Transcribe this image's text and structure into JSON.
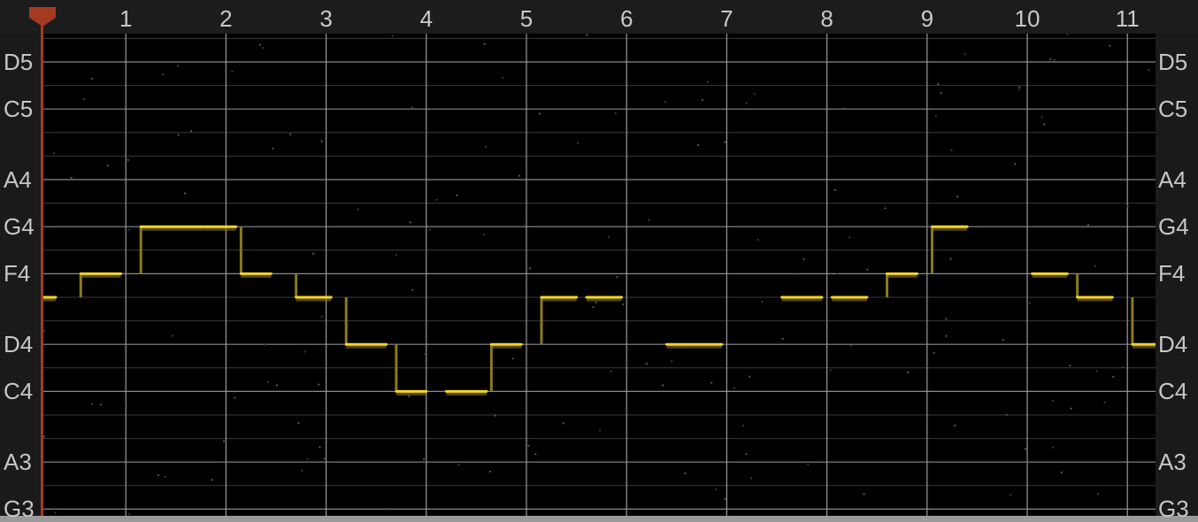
{
  "ruler": {
    "bars": [
      "1",
      "2",
      "3",
      "4",
      "5",
      "6",
      "7",
      "8",
      "9",
      "10",
      "11"
    ]
  },
  "notes": [
    {
      "name": "D5",
      "midi": 74
    },
    {
      "name": "C5",
      "midi": 72
    },
    {
      "name": "A4",
      "midi": 69
    },
    {
      "name": "G4",
      "midi": 67
    },
    {
      "name": "F4",
      "midi": 65
    },
    {
      "name": "D4",
      "midi": 62
    },
    {
      "name": "C4",
      "midi": 60
    },
    {
      "name": "A3",
      "midi": 57
    },
    {
      "name": "G3",
      "midi": 55
    }
  ],
  "pitch_segments": [
    {
      "start": 0.0,
      "end": 0.3,
      "note": "E4"
    },
    {
      "start": 0.55,
      "end": 0.95,
      "note": "F4"
    },
    {
      "start": 1.15,
      "end": 1.75,
      "note": "G4"
    },
    {
      "start": 1.75,
      "end": 2.1,
      "note": "G4"
    },
    {
      "start": 2.15,
      "end": 2.45,
      "note": "F4"
    },
    {
      "start": 2.7,
      "end": 3.05,
      "note": "E4"
    },
    {
      "start": 3.2,
      "end": 3.6,
      "note": "D4"
    },
    {
      "start": 3.7,
      "end": 4.0,
      "note": "C4"
    },
    {
      "start": 4.2,
      "end": 4.6,
      "note": "C4"
    },
    {
      "start": 4.65,
      "end": 4.95,
      "note": "D4"
    },
    {
      "start": 5.15,
      "end": 5.5,
      "note": "E4"
    },
    {
      "start": 5.6,
      "end": 5.95,
      "note": "E4"
    },
    {
      "start": 6.4,
      "end": 6.95,
      "note": "D4"
    },
    {
      "start": 7.55,
      "end": 7.95,
      "note": "E4"
    },
    {
      "start": 8.05,
      "end": 8.4,
      "note": "E4"
    },
    {
      "start": 8.6,
      "end": 8.9,
      "note": "F4"
    },
    {
      "start": 9.05,
      "end": 9.4,
      "note": "G4"
    },
    {
      "start": 10.05,
      "end": 10.4,
      "note": "F4"
    },
    {
      "start": 10.5,
      "end": 10.85,
      "note": "E4"
    },
    {
      "start": 11.05,
      "end": 11.3,
      "note": "D4"
    }
  ],
  "colors": {
    "pitch": "#f2d42b",
    "pitch_faint": "#8a7a1c",
    "playhead": "#a43a22",
    "grid_major": "#8a8a8a",
    "grid_minor": "#3a3a3a",
    "bar_line": "#9a9a9a"
  }
}
